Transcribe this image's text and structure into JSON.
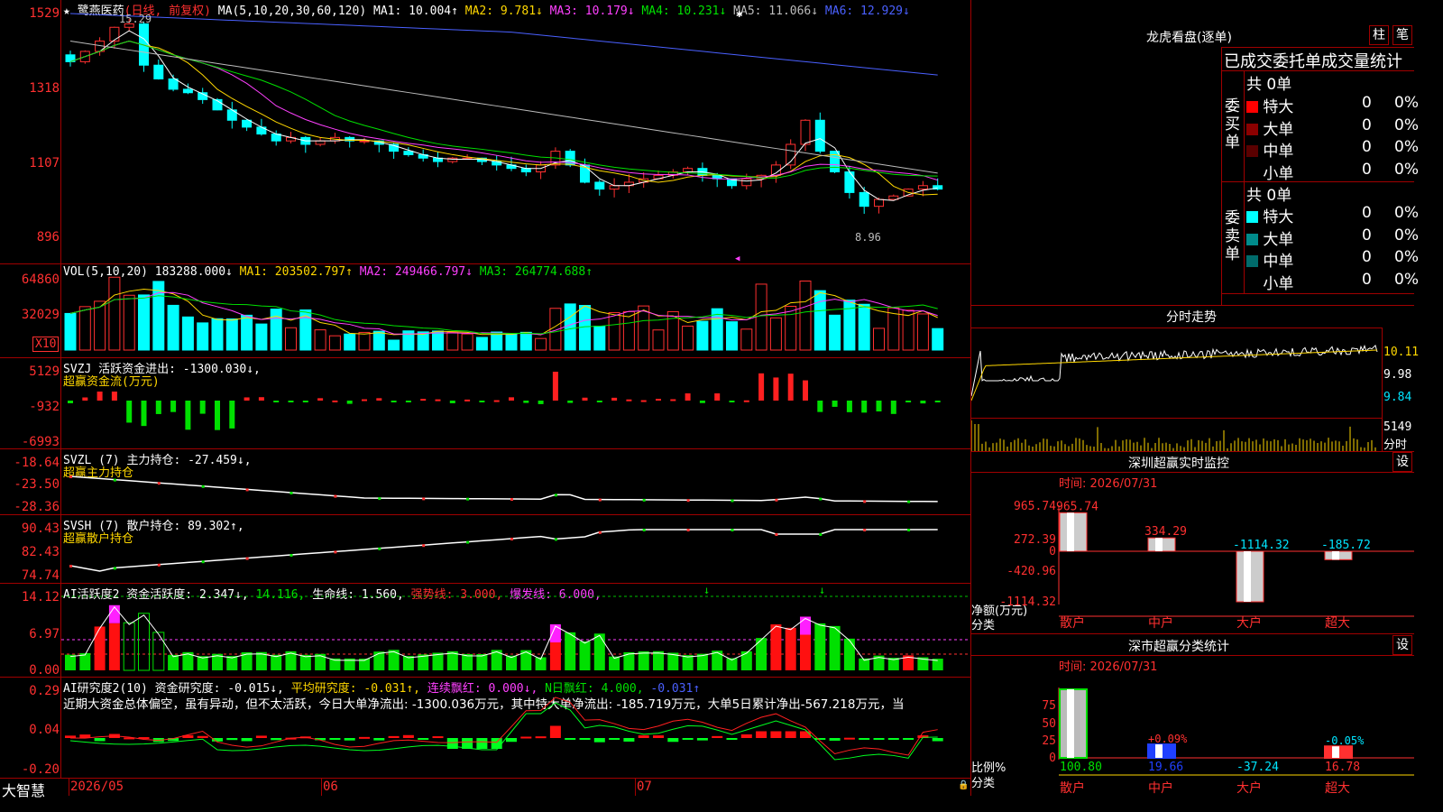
{
  "main": {
    "stock_name": "★ 鹭燕医药",
    "period": "(日线, 前复权)",
    "ma_head": "MA(5,10,20,30,60,120)",
    "ma": [
      {
        "label": "MA1: 10.004↑",
        "color": "#ffffff"
      },
      {
        "label": "MA2: 9.781↓",
        "color": "#ffd700"
      },
      {
        "label": "MA3: 10.179↓",
        "color": "#ff40ff"
      },
      {
        "label": "MA4: 10.231↓",
        "color": "#00e000"
      },
      {
        "label": "MA5: 11.066↓",
        "color": "#bbbbbb"
      },
      {
        "label": "MA6: 12.929↓",
        "color": "#4a60ff"
      }
    ],
    "axis": [
      "1529",
      "1318",
      "1107",
      "896"
    ],
    "high_label": "15.29",
    "low_label": "8.96"
  },
  "vol": {
    "head": "VOL(5,10,20)",
    "value": "183288.000↓",
    "ma": [
      {
        "label": "MA1: 203502.797↑",
        "color": "#ffd700"
      },
      {
        "label": "MA2: 249466.797↓",
        "color": "#ff40ff"
      },
      {
        "label": "MA3: 264774.688↑",
        "color": "#00e000"
      }
    ],
    "axis": [
      "64860",
      "32029"
    ],
    "unit": "X10"
  },
  "svzj": {
    "head": "SVZJ 活跃资金进出: -1300.030↓,",
    "sub": "超赢资金流(万元)",
    "axis": [
      "5129",
      "-932",
      "-6993"
    ]
  },
  "svzl": {
    "head": "SVZL (7) 主力持仓: -27.459↓,",
    "sub": "超赢主力持仓",
    "axis": [
      "-18.64",
      "-23.50",
      "-28.36"
    ]
  },
  "svsh": {
    "head": "SVSH (7) 散户持仓: 89.302↑,",
    "sub": "超赢散户持仓",
    "axis": [
      "90.43",
      "82.43",
      "74.74"
    ]
  },
  "ai1": {
    "head_a": "AI活跃度2 资金活跃度: 2.347↓,",
    "head_b": "14.116,",
    "head_c": "生命线: 1.560,",
    "head_d": "强势线: 3.000,",
    "head_e": "爆发线: 6.000,",
    "axis": [
      "14.12",
      "6.97",
      "0.00"
    ]
  },
  "ai2": {
    "head_a": "AI研究度2(10) 资金研究度: -0.015↓,",
    "head_b": "平均研究度: -0.031↑,",
    "head_c": "连续飘红: 0.000↓,",
    "head_d": "N日飘红: 4.000,",
    "head_e": "-0.031↑",
    "text": "近期大资金总体偏空，虽有异动，但不太活跃，今日大单净流出: -1300.036万元，其中特大单净流出: -185.719万元，大单5日累计净出-567.218万元，当",
    "axis": [
      "0.29",
      "0.04",
      "-0.20"
    ]
  },
  "bottom": {
    "brand": "大智慧",
    "dates": [
      "2026/05",
      "06",
      "07"
    ]
  },
  "lhb": {
    "title": "龙虎看盘(逐单)",
    "btn1": "柱",
    "btn2": "笔",
    "sub": "已成交委托单成交量统计",
    "buy_label": "委买单",
    "sell_label": "委卖单",
    "buy_total": "共 0单",
    "sell_total": "共 0单",
    "buy_rows": [
      {
        "name": "特大",
        "n": "0",
        "p": "0%",
        "color": "#ff0000"
      },
      {
        "name": "大单",
        "n": "0",
        "p": "0%",
        "color": "#8b0000"
      },
      {
        "name": "中单",
        "n": "0",
        "p": "0%",
        "color": "#5a0000"
      },
      {
        "name": "小单",
        "n": "0",
        "p": "0%",
        "color": "#000000"
      }
    ],
    "sell_rows": [
      {
        "name": "特大",
        "n": "0",
        "p": "0%",
        "color": "#00ffff"
      },
      {
        "name": "大单",
        "n": "0",
        "p": "0%",
        "color": "#008b8b"
      },
      {
        "name": "中单",
        "n": "0",
        "p": "0%",
        "color": "#006b6b"
      },
      {
        "name": "小单",
        "n": "0",
        "p": "0%",
        "color": "#000000"
      }
    ]
  },
  "fenshi": {
    "title": "分时走势",
    "axis": [
      "10.11",
      "9.98",
      "9.84"
    ],
    "vol_label": "5149",
    "label": "分时"
  },
  "monitor": {
    "title": "深圳超赢实时监控",
    "btn": "设",
    "time": "时间: 2026/07/31",
    "axis": [
      "965.74",
      "272.39",
      "0",
      "-420.96",
      "-1114.32"
    ],
    "unit": "净额(万元)",
    "cat_label": "分类",
    "bars": [
      {
        "name": "散户",
        "value": 965.74,
        "label": "965.74"
      },
      {
        "name": "中户",
        "value": 334.29,
        "label": "334.29"
      },
      {
        "name": "大户",
        "value": -1114.32,
        "label": "-1114.32"
      },
      {
        "name": "超大",
        "value": -185.72,
        "label": "-185.72"
      }
    ]
  },
  "classify": {
    "title": "深市超赢分类统计",
    "btn": "设",
    "time": "时间: 2026/07/31",
    "axis": [
      "75",
      "50",
      "25",
      "0"
    ],
    "ratio_label": "比例%",
    "cat_label": "分类",
    "bars": [
      {
        "name": "散户",
        "pct": 100.8,
        "value": "100.80",
        "tag": ""
      },
      {
        "name": "中户",
        "pct": 19.66,
        "value": "19.66",
        "tag": "+0.09%"
      },
      {
        "name": "大户",
        "pct": 0,
        "value": "-37.24",
        "tag": ""
      },
      {
        "name": "超大",
        "pct": 16.78,
        "value": "16.78",
        "tag": "-0.05%"
      }
    ]
  }
}
